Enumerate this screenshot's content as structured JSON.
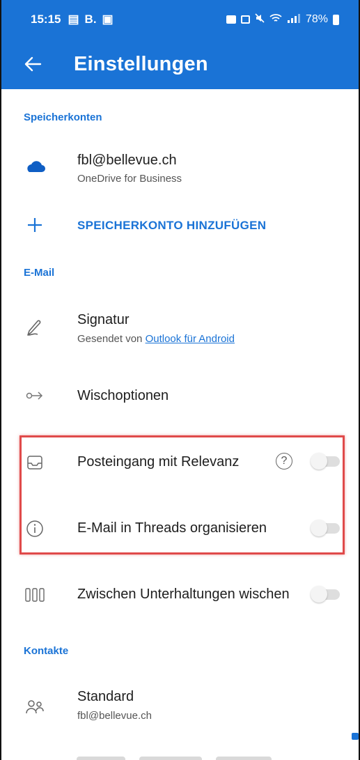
{
  "status_bar": {
    "time": "15:15",
    "left_icons": [
      "▤",
      "B.",
      "▣"
    ],
    "battery": "78%"
  },
  "header": {
    "back_icon": "arrow-left-icon",
    "title": "Einstellungen"
  },
  "sections": {
    "storage": {
      "heading": "Speicherkonten",
      "account_email": "fbl@bellevue.ch",
      "account_type": "OneDrive for Business",
      "add_label": "SPEICHERKONTO HINZUFÜGEN"
    },
    "mail": {
      "heading": "E-Mail",
      "signature_label": "Signatur",
      "signature_sub_prefix": "Gesendet von ",
      "signature_sub_link": "Outlook für Android",
      "swipe_label": "Wischoptionen",
      "focused_inbox_label": "Posteingang mit Relevanz",
      "help_icon": "?",
      "threads_label": "E-Mail in Threads organisieren",
      "swipe_conv_label": "Zwischen Unterhaltungen wischen"
    },
    "contacts": {
      "heading": "Kontakte",
      "default_label": "Standard",
      "default_sub": "fbl@bellevue.ch"
    }
  },
  "toggles": {
    "focused_inbox": false,
    "threads": false,
    "swipe_conversations": false
  },
  "colors": {
    "accent": "#1a73d6",
    "highlight": "#e04a4a"
  }
}
